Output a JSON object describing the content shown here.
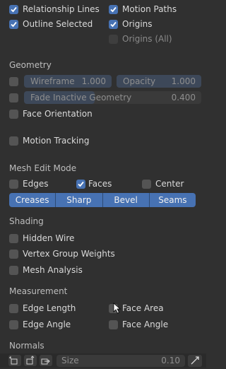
{
  "overlays_top": {
    "relationship_lines": {
      "label": "Relationship Lines",
      "checked": true
    },
    "motion_paths": {
      "label": "Motion Paths",
      "checked": true
    },
    "outline_selected": {
      "label": "Outline Selected",
      "checked": true
    },
    "origins": {
      "label": "Origins",
      "checked": true
    },
    "origins_all": {
      "label": "Origins (All)",
      "checked": false
    }
  },
  "geometry": {
    "title": "Geometry",
    "wireframe": {
      "label": "Wireframe",
      "value": "1.000",
      "checked": false
    },
    "opacity": {
      "label": "Opacity",
      "value": "1.000"
    },
    "fade_inactive": {
      "label": "Fade Inactive Geometry",
      "value": "0.400",
      "checked": false
    },
    "face_orientation": {
      "label": "Face Orientation",
      "checked": false
    }
  },
  "motion_tracking": {
    "label": "Motion Tracking",
    "checked": false
  },
  "mesh_edit_mode": {
    "title": "Mesh Edit Mode",
    "edges": {
      "label": "Edges",
      "checked": false
    },
    "faces": {
      "label": "Faces",
      "checked": true
    },
    "center": {
      "label": "Center",
      "checked": false
    },
    "buttons": [
      "Creases",
      "Sharp",
      "Bevel",
      "Seams"
    ]
  },
  "shading": {
    "title": "Shading",
    "hidden_wire": {
      "label": "Hidden Wire",
      "checked": false
    },
    "vertex_group_weights": {
      "label": "Vertex Group Weights",
      "checked": false
    },
    "mesh_analysis": {
      "label": "Mesh Analysis",
      "checked": false
    }
  },
  "measurement": {
    "title": "Measurement",
    "edge_length": {
      "label": "Edge Length",
      "checked": false
    },
    "face_area": {
      "label": "Face Area",
      "checked": false
    },
    "edge_angle": {
      "label": "Edge Angle",
      "checked": false
    },
    "face_angle": {
      "label": "Face Angle",
      "checked": false
    }
  },
  "normals": {
    "title": "Normals",
    "size": {
      "label": "Size",
      "value": "0.10"
    }
  },
  "colors": {
    "accent": "#4772b3",
    "panel": "#303030"
  }
}
